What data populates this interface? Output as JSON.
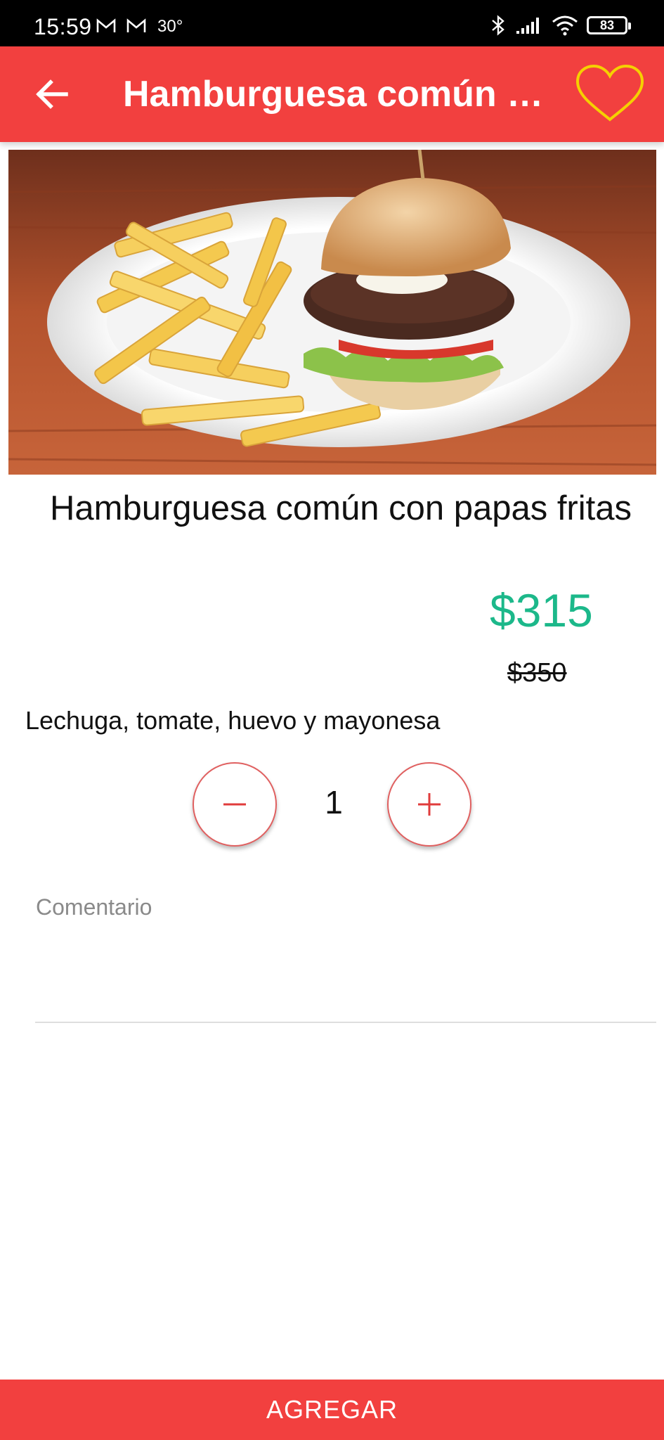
{
  "status_bar": {
    "time": "15:59",
    "temperature": "30°",
    "battery": "83",
    "icons": [
      "gmail-icon",
      "gmail-icon",
      "bluetooth-icon",
      "signal-icon",
      "wifi-icon",
      "battery-icon"
    ]
  },
  "app_bar": {
    "title": "Hamburguesa común con papas fritas",
    "back_icon": "arrow-left-icon",
    "favorite_icon": "heart-outline-icon",
    "background_color": "#f2403f",
    "favorite_color": "#f5d000"
  },
  "product": {
    "image": "burger-and-fries-photo",
    "name": "Hamburguesa común con papas fritas",
    "price": "$315",
    "original_price": "$350",
    "description": "Lechuga, tomate, huevo y mayonesa",
    "price_color": "#1cb88a"
  },
  "quantity": {
    "value": "1",
    "decrement_icon": "minus-icon",
    "increment_icon": "plus-icon"
  },
  "comment": {
    "placeholder": "Comentario"
  },
  "footer": {
    "add_label": "AGREGAR"
  }
}
